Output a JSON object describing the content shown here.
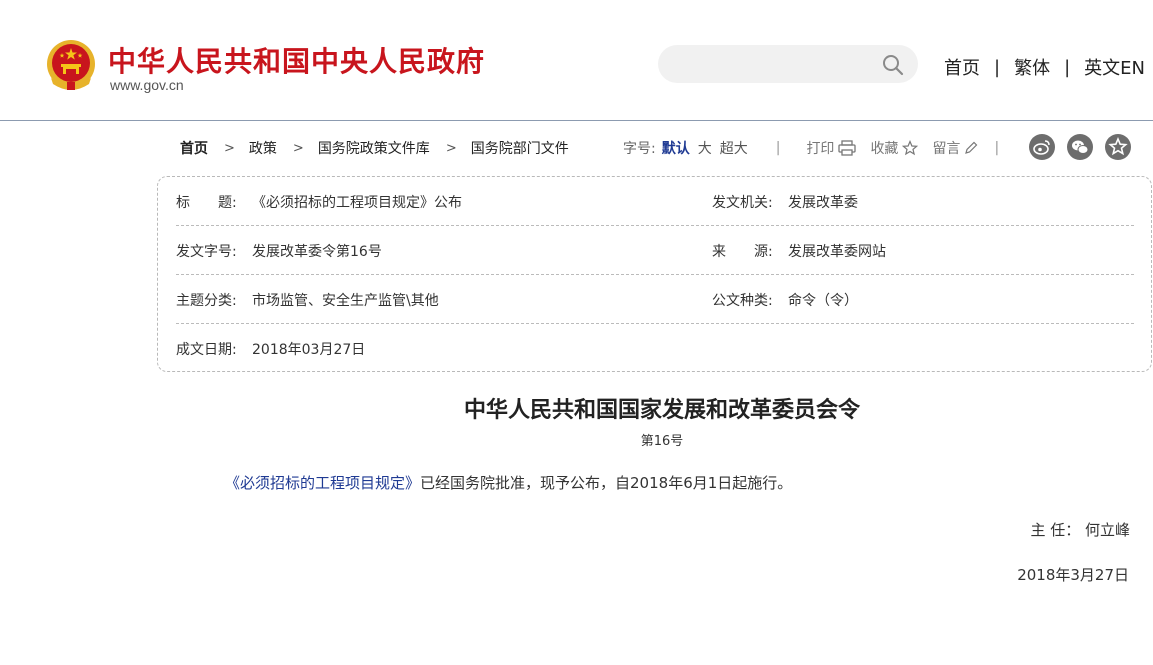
{
  "header": {
    "site_title": "中华人民共和国中央人民政府",
    "site_url": "www.gov.cn",
    "search_placeholder": "",
    "nav": [
      "首页",
      "繁体",
      "英文EN"
    ],
    "nav_separator": "|"
  },
  "breadcrumb": {
    "items": [
      "首页",
      "政策",
      "国务院政策文件库",
      "国务院部门文件"
    ],
    "separator": ">"
  },
  "toolbar": {
    "font_size_label": "字号:",
    "font_default": "默认",
    "font_large": "大",
    "font_xlarge": "超大",
    "divider": "|",
    "print": "打印",
    "favorite": "收藏",
    "comment": "留言"
  },
  "info": {
    "title_label": "标　　题:",
    "title_value": "《必须招标的工程项目规定》公布",
    "issuer_label": "发文机关:",
    "issuer_value": "发展改革委",
    "doc_no_label": "发文字号:",
    "doc_no_value": "发展改革委令第16号",
    "source_label": "来　　源:",
    "source_value": "发展改革委网站",
    "topic_label": "主题分类:",
    "topic_value": "市场监管、安全生产监管\\其他",
    "doctype_label": "公文种类:",
    "doctype_value": "命令（令）",
    "date_label": "成文日期:",
    "date_value": "2018年03月27日"
  },
  "article": {
    "title": "中华人民共和国国家发展和改革委员会令",
    "number": "第16号",
    "link_text": "《必须招标的工程项目规定》",
    "body_rest": "已经国务院批准，现予公布，自2018年6月1日起施行。",
    "signature": "主  任：  何立峰",
    "date": "2018年3月27日"
  },
  "colors": {
    "brand_red": "#c8151d",
    "accent_blue": "#1f3a93",
    "share_icon_gray": "#6d6d6d"
  },
  "icons": [
    "national-emblem",
    "search-icon",
    "print-icon",
    "star-icon",
    "pencil-icon",
    "weibo-icon",
    "wechat-icon",
    "star-share-icon"
  ]
}
